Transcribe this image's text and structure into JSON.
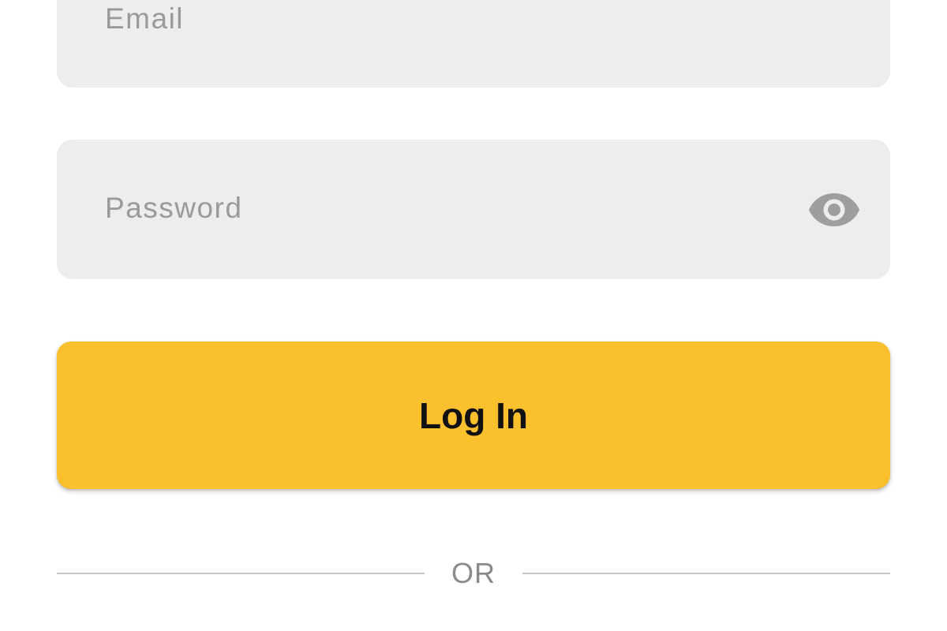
{
  "form": {
    "email_placeholder": "Email",
    "password_placeholder": "Password",
    "password_toggle_icon": "eye-icon",
    "login_label": "Log In",
    "divider_text": "OR"
  },
  "colors": {
    "field_background": "#ededed",
    "placeholder_text": "#9a9a9a",
    "icon": "#9e9e9e",
    "login_button": "#fbc02d",
    "login_text": "#111111",
    "divider_line": "#c6c6c6",
    "divider_text": "#8a8a8a"
  }
}
